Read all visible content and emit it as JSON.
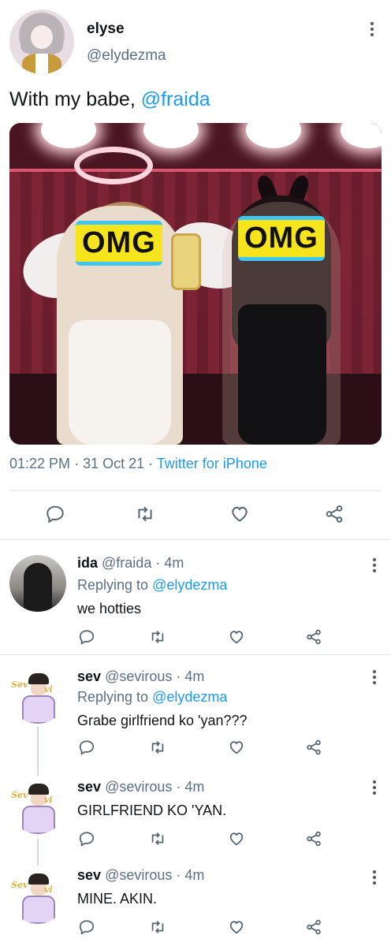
{
  "tweet": {
    "author_name": "elyse",
    "author_handle": "@elydezma",
    "text_prefix": "With my babe, ",
    "text_mention": "@fraida",
    "image_overlay_left": "OMG",
    "image_overlay_right": "OMG",
    "time": "01:22 PM",
    "date": "31 Oct 21",
    "separator": "·",
    "source": "Twitter for iPhone"
  },
  "icons": {
    "reply": "reply-icon",
    "retweet": "retweet-icon",
    "like": "heart-icon",
    "share": "share-icon",
    "menu": "more-icon"
  },
  "colors": {
    "link": "#1d9bf0",
    "muted": "#5b7083",
    "divider": "#e1e8ed"
  },
  "replies": [
    {
      "name": "ida",
      "handle": "@fraida",
      "separator": "·",
      "time": "4m",
      "replying_label": "Replying to ",
      "replying_to": "@elydezma",
      "text": "we hotties"
    },
    {
      "name": "sev",
      "handle": "@sevirous",
      "separator": "·",
      "time": "4m",
      "replying_label": "Replying to ",
      "replying_to": "@elydezma",
      "text": "Grabe girlfriend ko 'yan???",
      "avatar_text_left": "Sev",
      "avatar_text_right": "vi"
    },
    {
      "name": "sev",
      "handle": "@sevirous",
      "separator": "·",
      "time": "4m",
      "text": "GIRLFRIEND KO 'YAN.",
      "avatar_text_left": "Sev",
      "avatar_text_right": "vi"
    },
    {
      "name": "sev",
      "handle": "@sevirous",
      "separator": "·",
      "time": "4m",
      "text": "MINE. AKIN.",
      "avatar_text_left": "Sev",
      "avatar_text_right": "vi"
    }
  ]
}
